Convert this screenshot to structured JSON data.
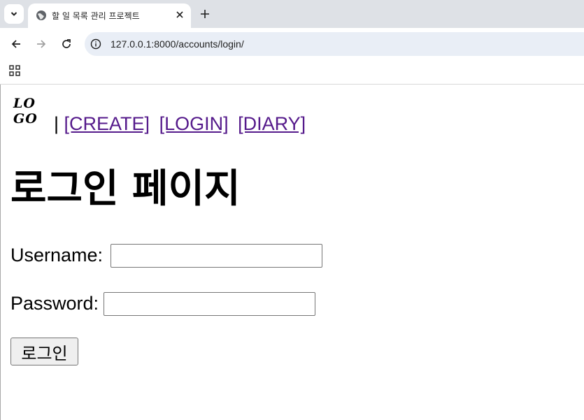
{
  "browser": {
    "tab_title": "할 일 목록 관리 프로젝트",
    "url": "127.0.0.1:8000/accounts/login/",
    "icons": {
      "tab_search": "chevron-down-icon",
      "favicon": "globe-icon",
      "tab_close": "close-icon",
      "new_tab": "plus-icon",
      "back": "arrow-left-icon",
      "forward": "arrow-right-icon",
      "reload": "reload-icon",
      "site_info": "info-icon",
      "apps": "apps-grid-icon"
    }
  },
  "page": {
    "logo": {
      "line1": "LO",
      "line2": "GO"
    },
    "nav": {
      "separator": "|",
      "links": [
        "[CREATE]",
        "[LOGIN]",
        "[DIARY]"
      ]
    },
    "heading": "로그인 페이지",
    "form": {
      "username_label": "Username:",
      "username_value": "",
      "password_label": "Password:",
      "password_value": "",
      "submit_label": "로그인"
    }
  },
  "colors": {
    "link_visited": "#551a8b",
    "tabstrip_bg": "#dee1e6",
    "omnibox_bg": "#e9eef6"
  }
}
